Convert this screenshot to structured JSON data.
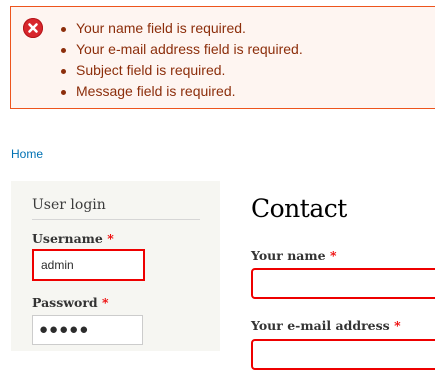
{
  "messages": {
    "errors": [
      "Your name field is required.",
      "Your e-mail address field is required.",
      "Subject field is required.",
      "Message field is required."
    ]
  },
  "breadcrumb": {
    "home": "Home"
  },
  "login_block": {
    "title": "User login",
    "username_label": "Username",
    "username_value": "admin",
    "password_label": "Password",
    "password_mask": "●●●●●",
    "required_marker": "*"
  },
  "contact": {
    "title": "Contact",
    "name_label": "Your name",
    "email_label": "Your e-mail address",
    "required_marker": "*"
  },
  "colors": {
    "error_text": "#8c2e0b",
    "error_border": "#ed541d",
    "error_background": "#fef5f1",
    "required": "#ee0000",
    "link": "#0071b3"
  },
  "icons": {
    "error": "error-x-circle-icon"
  }
}
